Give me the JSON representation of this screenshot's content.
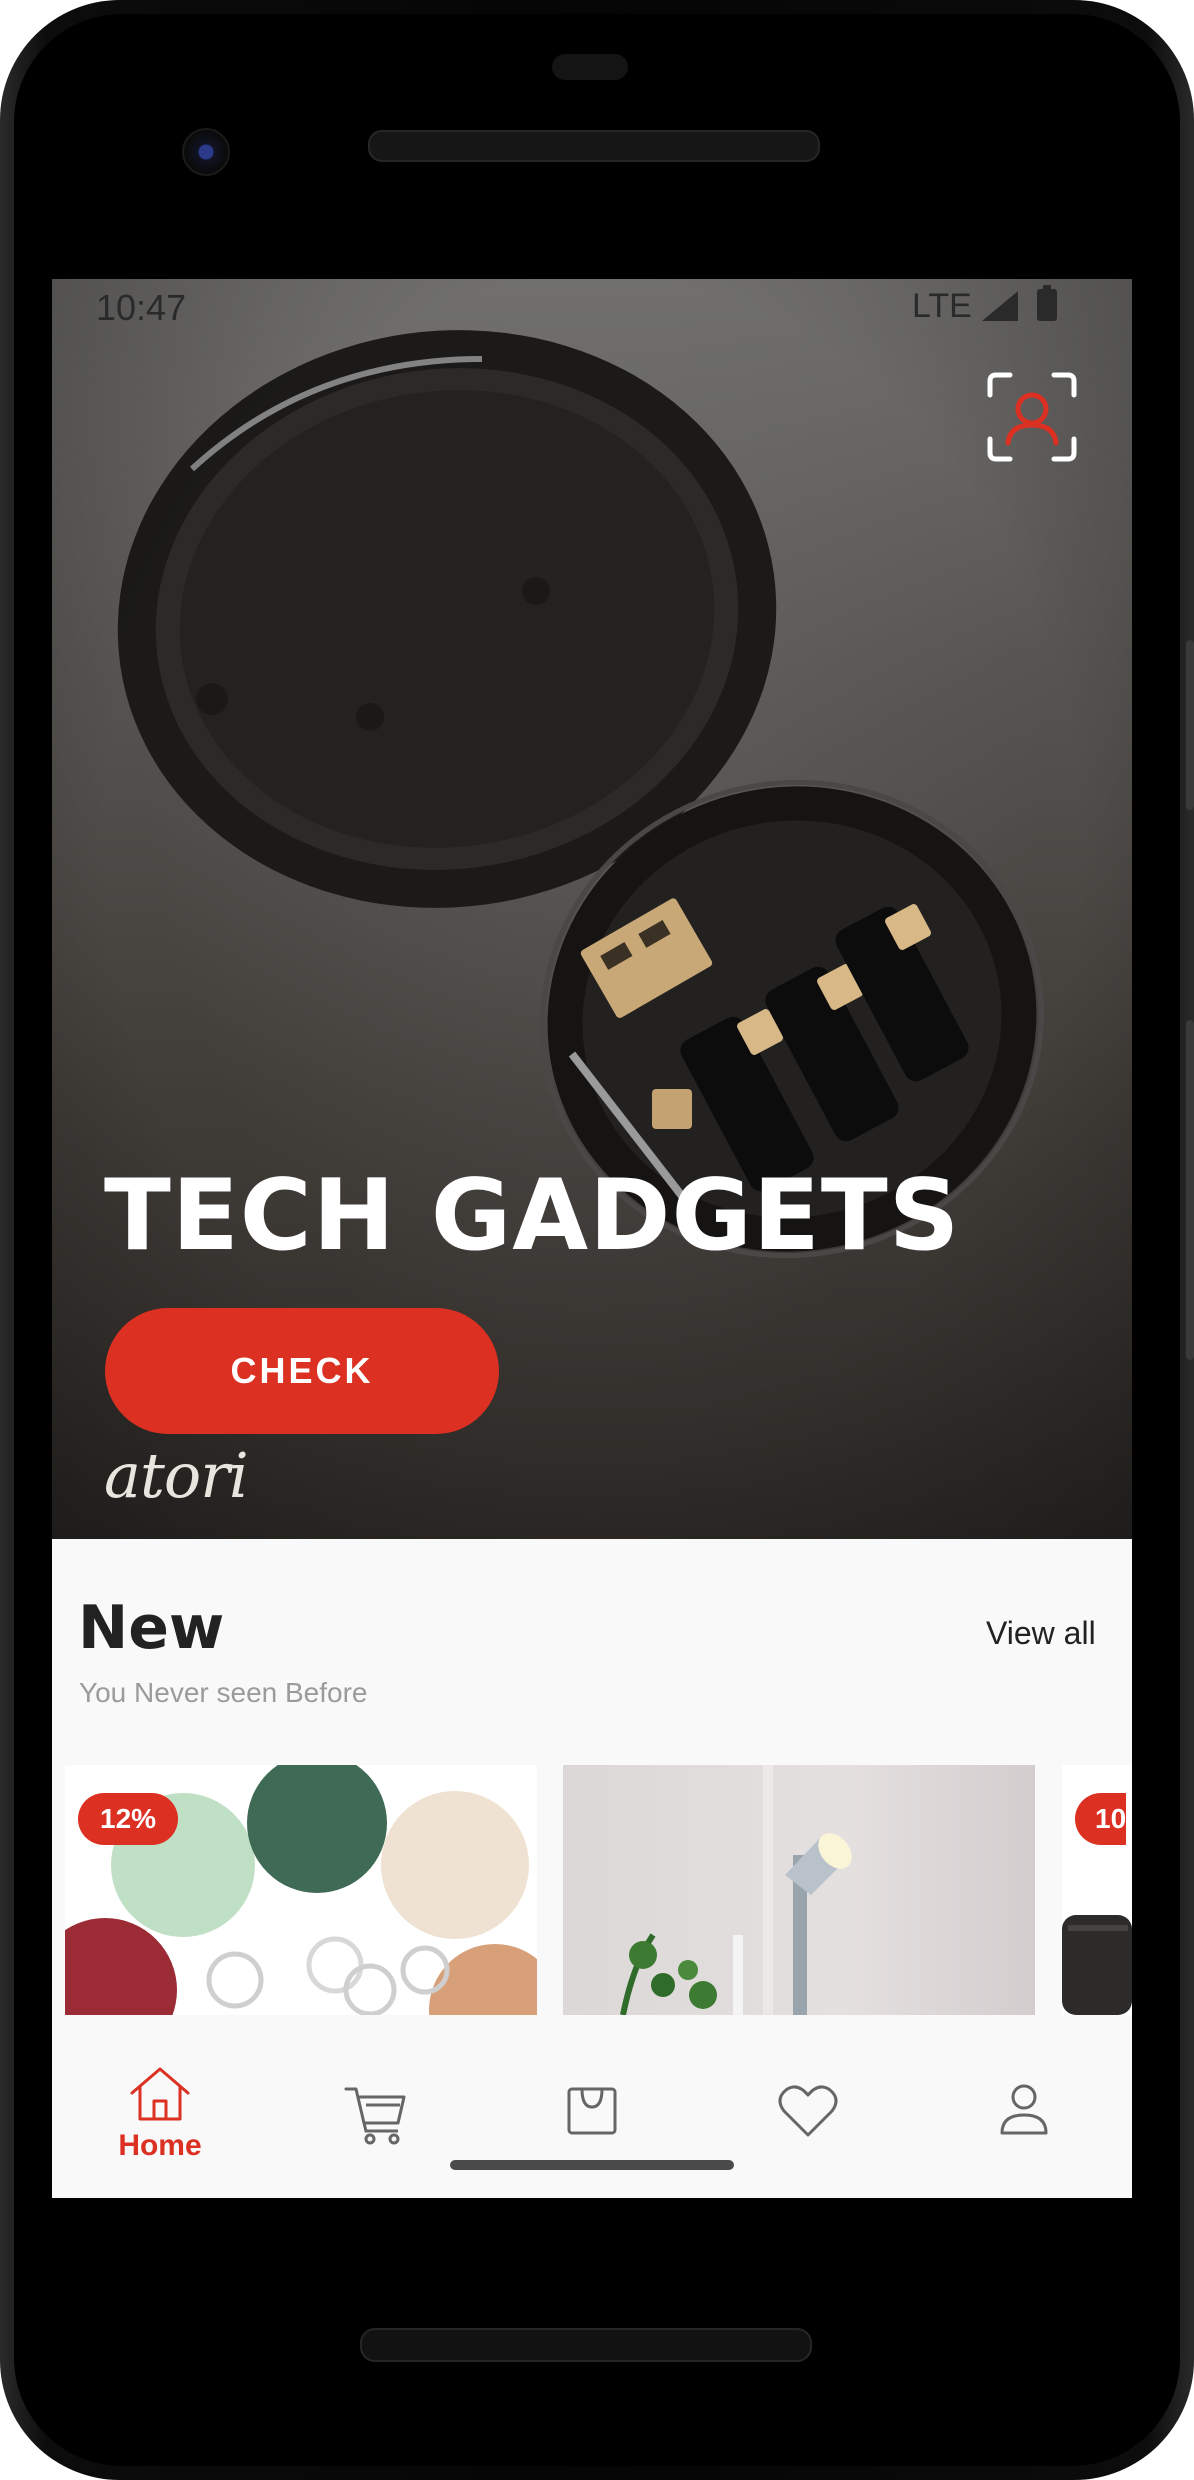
{
  "status_bar": {
    "time": "10:47",
    "network": "LTE"
  },
  "hero": {
    "title": "TECH GADGETS",
    "cta_label": "CHECK",
    "brand": "atori"
  },
  "new_section": {
    "title": "New",
    "subtitle": "You Never seen Before",
    "view_all": "View all",
    "cards": [
      {
        "badge": "12%",
        "image": "keychain-tokens-photo"
      },
      {
        "badge": "",
        "image": "desk-lamp-photo"
      },
      {
        "badge": "10",
        "image": "bag-photo"
      }
    ]
  },
  "tabbar": {
    "items": [
      {
        "label": "Home",
        "icon": "home-icon",
        "active": true
      },
      {
        "label": "",
        "icon": "cart-icon",
        "active": false
      },
      {
        "label": "",
        "icon": "bag-icon",
        "active": false
      },
      {
        "label": "",
        "icon": "heart-icon",
        "active": false
      },
      {
        "label": "",
        "icon": "profile-icon",
        "active": false
      }
    ]
  },
  "colors": {
    "accent": "#DB3022",
    "text": "#222222",
    "muted": "#9B9B9B",
    "background": "#F9F9F9"
  }
}
